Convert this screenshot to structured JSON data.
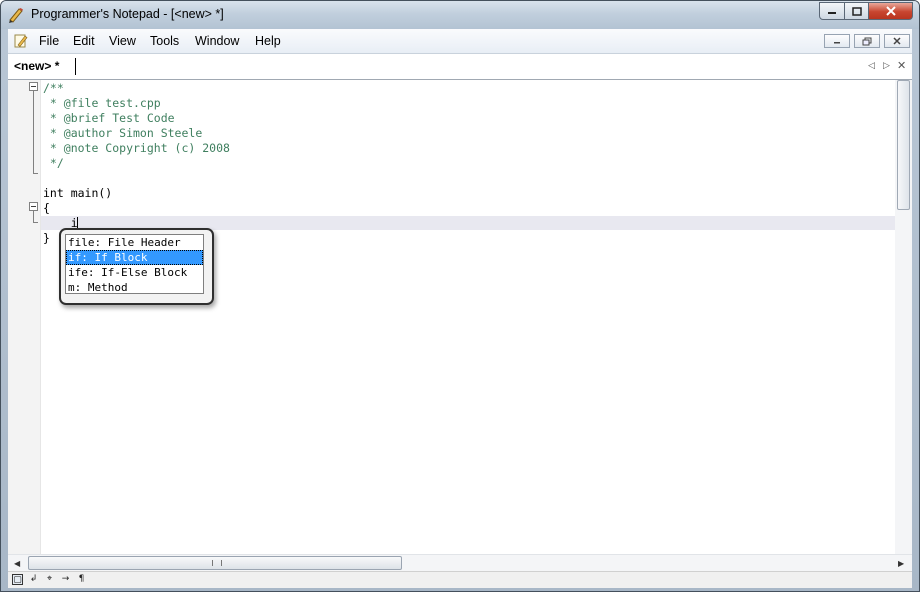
{
  "window": {
    "title": "Programmer's Notepad - [<new> *]"
  },
  "menu": [
    "File",
    "Edit",
    "View",
    "Tools",
    "Window",
    "Help"
  ],
  "tabs": [
    {
      "label": "<new> *"
    }
  ],
  "editor": {
    "lines": [
      {
        "text": "/**",
        "style": "cmt"
      },
      {
        "text": " * @file test.cpp",
        "style": "cmt"
      },
      {
        "text": " * @brief Test Code",
        "style": "cmt"
      },
      {
        "text": " * @author Simon Steele",
        "style": "cmt"
      },
      {
        "text": " * @note Copyright (c) 2008",
        "style": "cmt"
      },
      {
        "text": " */",
        "style": "cmt"
      },
      {
        "text": "",
        "style": "kw"
      },
      {
        "text": "int main()",
        "style": "kw"
      },
      {
        "text": "{",
        "style": "kw"
      },
      {
        "text": "    i",
        "style": "kw"
      },
      {
        "text": "}",
        "style": "kw"
      }
    ]
  },
  "autocomplete": {
    "items": [
      "file: File Header",
      "if: If Block",
      "ife: If-Else Block",
      "m: Method"
    ],
    "selected_index": 1
  },
  "colors": {
    "comment": "#3f7f5f",
    "selection": "#3399ff",
    "current_line": "#e8e8f0"
  }
}
